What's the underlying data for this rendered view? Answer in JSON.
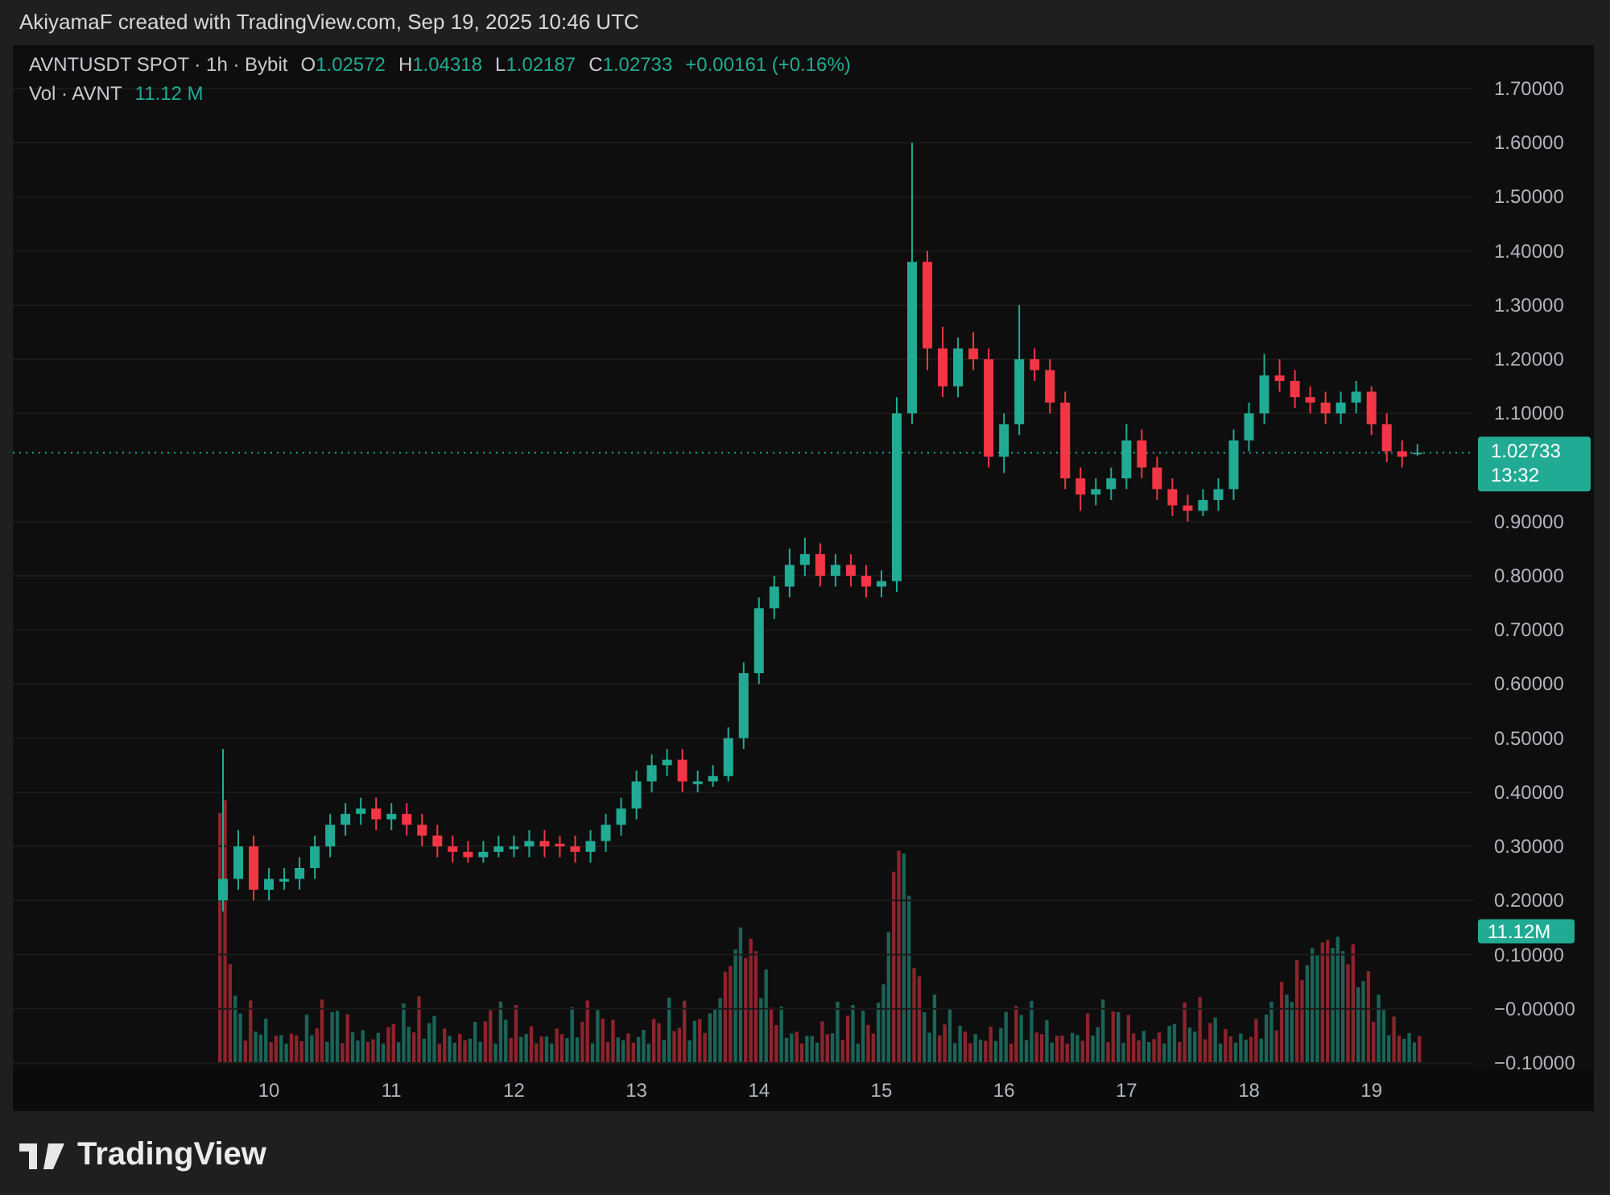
{
  "attribution": "AkiyamaF created with TradingView.com, Sep 19, 2025 10:46 UTC",
  "legend": {
    "symbol": "AVNTUSDT SPOT · 1h · Bybit",
    "ohlc": [
      {
        "label": "O",
        "value": "1.02572"
      },
      {
        "label": "H",
        "value": "1.04318"
      },
      {
        "label": "L",
        "value": "1.02187"
      },
      {
        "label": "C",
        "value": "1.02733"
      }
    ],
    "change": "+0.00161 (+0.16%)"
  },
  "volume_legend": {
    "label": "Vol · AVNT",
    "value": "11.12 M"
  },
  "chart": {
    "chart_data": {
      "type": "candlestick",
      "grid": true,
      "xlim": [
        7.91,
        19.83
      ],
      "ylim": [
        -0.1,
        1.7
      ],
      "x": [
        9.625,
        9.75,
        9.875,
        10,
        10.125,
        10.25,
        10.375,
        10.5,
        10.625,
        10.75,
        10.875,
        11,
        11.125,
        11.25,
        11.375,
        11.5,
        11.625,
        11.75,
        11.875,
        12,
        12.125,
        12.25,
        12.375,
        12.5,
        12.625,
        12.75,
        12.875,
        13,
        13.125,
        13.25,
        13.375,
        13.5,
        13.625,
        13.75,
        13.875,
        14,
        14.125,
        14.25,
        14.375,
        14.5,
        14.625,
        14.75,
        14.875,
        15,
        15.125,
        15.25,
        15.375,
        15.5,
        15.625,
        15.75,
        15.875,
        16,
        16.125,
        16.25,
        16.375,
        16.5,
        16.625,
        16.75,
        16.875,
        17,
        17.125,
        17.25,
        17.375,
        17.5,
        17.625,
        17.75,
        17.875,
        18,
        18.125,
        18.25,
        18.375,
        18.5,
        18.625,
        18.75,
        18.875,
        19,
        19.125,
        19.25,
        19.375
      ],
      "ohlc": [
        [
          0.2,
          0.48,
          0.18,
          0.24
        ],
        [
          0.24,
          0.33,
          0.22,
          0.3
        ],
        [
          0.3,
          0.32,
          0.2,
          0.22
        ],
        [
          0.22,
          0.26,
          0.2,
          0.24
        ],
        [
          0.235,
          0.26,
          0.22,
          0.24
        ],
        [
          0.24,
          0.28,
          0.22,
          0.26
        ],
        [
          0.26,
          0.32,
          0.24,
          0.3
        ],
        [
          0.3,
          0.36,
          0.28,
          0.34
        ],
        [
          0.34,
          0.38,
          0.32,
          0.36
        ],
        [
          0.36,
          0.39,
          0.34,
          0.37
        ],
        [
          0.37,
          0.39,
          0.33,
          0.35
        ],
        [
          0.35,
          0.38,
          0.33,
          0.36
        ],
        [
          0.36,
          0.38,
          0.32,
          0.34
        ],
        [
          0.34,
          0.36,
          0.3,
          0.32
        ],
        [
          0.32,
          0.34,
          0.28,
          0.3
        ],
        [
          0.3,
          0.32,
          0.27,
          0.29
        ],
        [
          0.29,
          0.31,
          0.27,
          0.28
        ],
        [
          0.28,
          0.31,
          0.27,
          0.29
        ],
        [
          0.29,
          0.32,
          0.28,
          0.3
        ],
        [
          0.295,
          0.32,
          0.28,
          0.3
        ],
        [
          0.3,
          0.33,
          0.28,
          0.31
        ],
        [
          0.31,
          0.33,
          0.28,
          0.3
        ],
        [
          0.305,
          0.32,
          0.28,
          0.3
        ],
        [
          0.3,
          0.32,
          0.27,
          0.29
        ],
        [
          0.29,
          0.33,
          0.27,
          0.31
        ],
        [
          0.31,
          0.36,
          0.29,
          0.34
        ],
        [
          0.34,
          0.39,
          0.32,
          0.37
        ],
        [
          0.37,
          0.44,
          0.35,
          0.42
        ],
        [
          0.42,
          0.47,
          0.4,
          0.45
        ],
        [
          0.45,
          0.48,
          0.43,
          0.46
        ],
        [
          0.46,
          0.48,
          0.4,
          0.42
        ],
        [
          0.415,
          0.44,
          0.4,
          0.42
        ],
        [
          0.42,
          0.45,
          0.41,
          0.43
        ],
        [
          0.43,
          0.52,
          0.42,
          0.5
        ],
        [
          0.5,
          0.64,
          0.48,
          0.62
        ],
        [
          0.62,
          0.76,
          0.6,
          0.74
        ],
        [
          0.74,
          0.8,
          0.72,
          0.78
        ],
        [
          0.78,
          0.85,
          0.76,
          0.82
        ],
        [
          0.82,
          0.87,
          0.8,
          0.84
        ],
        [
          0.84,
          0.86,
          0.78,
          0.8
        ],
        [
          0.8,
          0.84,
          0.78,
          0.82
        ],
        [
          0.82,
          0.84,
          0.78,
          0.8
        ],
        [
          0.8,
          0.82,
          0.76,
          0.78
        ],
        [
          0.78,
          0.81,
          0.76,
          0.79
        ],
        [
          0.79,
          1.13,
          0.77,
          1.1
        ],
        [
          1.1,
          1.6,
          1.08,
          1.38
        ],
        [
          1.38,
          1.4,
          1.18,
          1.22
        ],
        [
          1.22,
          1.26,
          1.13,
          1.15
        ],
        [
          1.15,
          1.24,
          1.13,
          1.22
        ],
        [
          1.22,
          1.25,
          1.18,
          1.2
        ],
        [
          1.2,
          1.22,
          1.0,
          1.02
        ],
        [
          1.02,
          1.1,
          0.99,
          1.08
        ],
        [
          1.08,
          1.3,
          1.06,
          1.2
        ],
        [
          1.2,
          1.22,
          1.16,
          1.18
        ],
        [
          1.18,
          1.2,
          1.1,
          1.12
        ],
        [
          1.12,
          1.14,
          0.96,
          0.98
        ],
        [
          0.98,
          1.0,
          0.92,
          0.95
        ],
        [
          0.95,
          0.98,
          0.93,
          0.96
        ],
        [
          0.96,
          1.0,
          0.94,
          0.98
        ],
        [
          0.98,
          1.08,
          0.96,
          1.05
        ],
        [
          1.05,
          1.07,
          0.98,
          1.0
        ],
        [
          1.0,
          1.02,
          0.94,
          0.96
        ],
        [
          0.96,
          0.98,
          0.91,
          0.93
        ],
        [
          0.93,
          0.95,
          0.9,
          0.92
        ],
        [
          0.92,
          0.96,
          0.91,
          0.94
        ],
        [
          0.94,
          0.98,
          0.92,
          0.96
        ],
        [
          0.96,
          1.07,
          0.94,
          1.05
        ],
        [
          1.05,
          1.12,
          1.03,
          1.1
        ],
        [
          1.1,
          1.21,
          1.08,
          1.17
        ],
        [
          1.17,
          1.2,
          1.14,
          1.16
        ],
        [
          1.16,
          1.18,
          1.11,
          1.13
        ],
        [
          1.13,
          1.15,
          1.1,
          1.12
        ],
        [
          1.12,
          1.14,
          1.08,
          1.1
        ],
        [
          1.1,
          1.14,
          1.08,
          1.12
        ],
        [
          1.12,
          1.16,
          1.1,
          1.14
        ],
        [
          1.14,
          1.15,
          1.06,
          1.08
        ],
        [
          1.08,
          1.1,
          1.01,
          1.03
        ],
        [
          1.03,
          1.05,
          1.0,
          1.02
        ],
        [
          1.02572,
          1.04318,
          1.02187,
          1.02733
        ]
      ],
      "xticks": [
        {
          "value": 10,
          "label": "10"
        },
        {
          "value": 11,
          "label": "11"
        },
        {
          "value": 12,
          "label": "12"
        },
        {
          "value": 13,
          "label": "13"
        },
        {
          "value": 14,
          "label": "14"
        },
        {
          "value": 15,
          "label": "15"
        },
        {
          "value": 16,
          "label": "16"
        },
        {
          "value": 17,
          "label": "17"
        },
        {
          "value": 18,
          "label": "18"
        },
        {
          "value": 19,
          "label": "19"
        }
      ],
      "yticks": [
        {
          "value": 1.7,
          "label": "1.70000"
        },
        {
          "value": 1.6,
          "label": "1.60000"
        },
        {
          "value": 1.5,
          "label": "1.50000"
        },
        {
          "value": 1.4,
          "label": "1.40000"
        },
        {
          "value": 1.3,
          "label": "1.30000"
        },
        {
          "value": 1.2,
          "label": "1.20000"
        },
        {
          "value": 1.1,
          "label": "1.10000"
        },
        {
          "value": 0.9,
          "label": "0.90000"
        },
        {
          "value": 0.8,
          "label": "0.80000"
        },
        {
          "value": 0.7,
          "label": "0.70000"
        },
        {
          "value": 0.6,
          "label": "0.60000"
        },
        {
          "value": 0.5,
          "label": "0.50000"
        },
        {
          "value": 0.4,
          "label": "0.40000"
        },
        {
          "value": 0.3,
          "label": "0.30000"
        },
        {
          "value": 0.2,
          "label": "0.20000"
        },
        {
          "value": 0.1,
          "label": "0.10000"
        },
        {
          "value": 0,
          "label": "−0.00000"
        },
        {
          "value": -0.1,
          "label": "−0.10000"
        }
      ]
    }
  },
  "last_price": {
    "value": "1.02733",
    "countdown": "13:32"
  },
  "volume_badge": "11.12M",
  "logo": "TradingView"
}
